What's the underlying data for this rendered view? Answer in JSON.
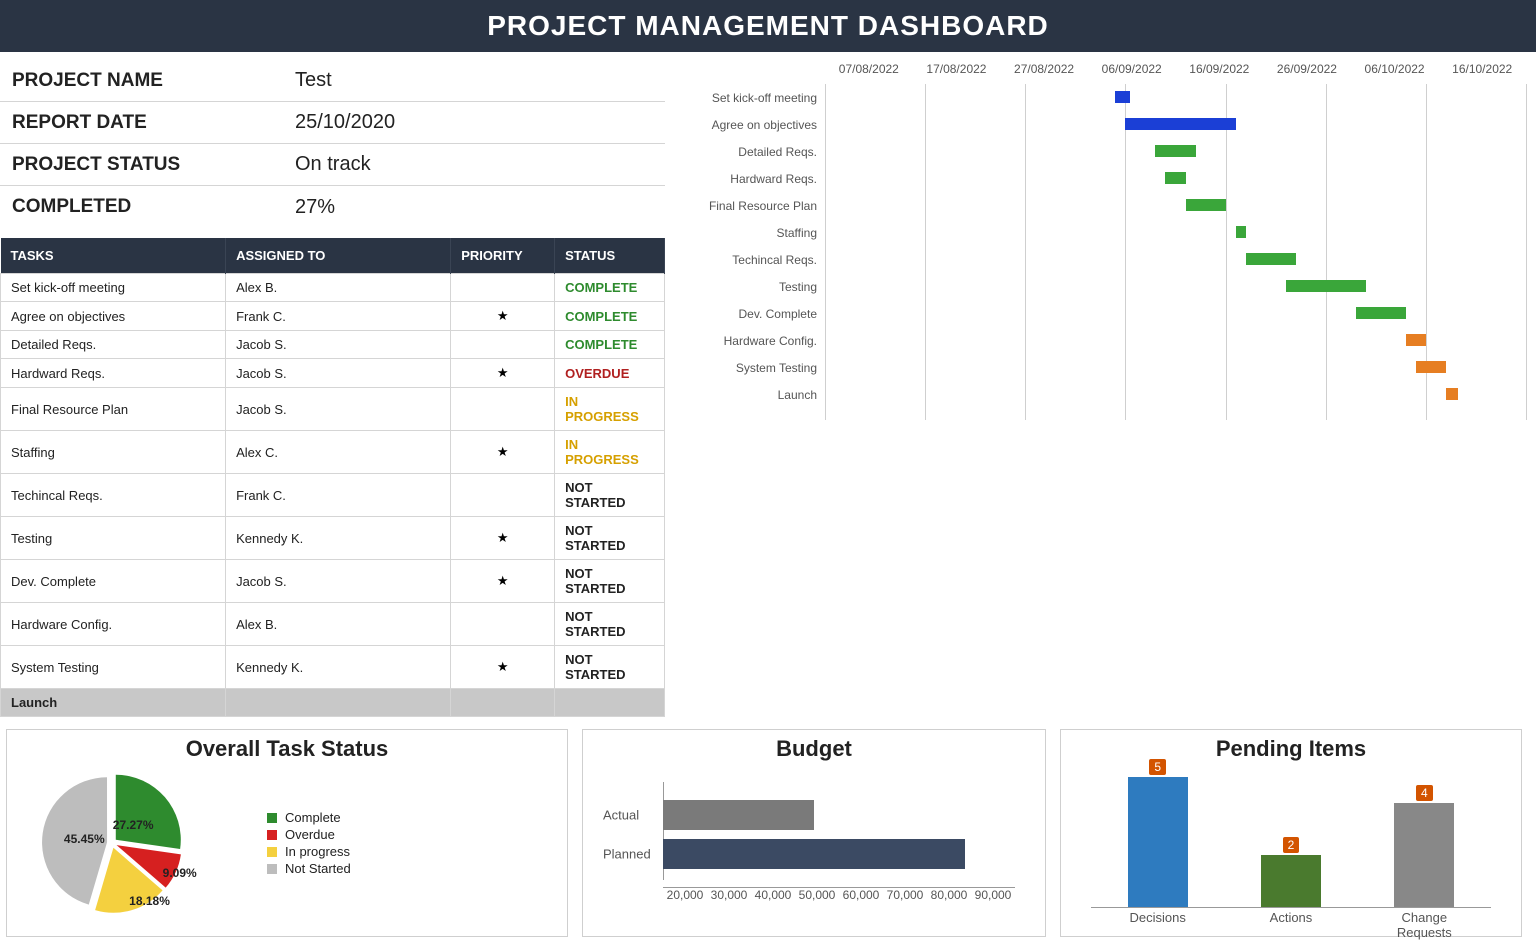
{
  "banner": "PROJECT MANAGEMENT DASHBOARD",
  "summary": [
    {
      "label": "PROJECT NAME",
      "value": "Test"
    },
    {
      "label": "REPORT DATE",
      "value": "25/10/2020"
    },
    {
      "label": "PROJECT STATUS",
      "value": "On track"
    },
    {
      "label": "COMPLETED",
      "value": "27%"
    }
  ],
  "task_table": {
    "headers": {
      "tasks": "TASKS",
      "assigned": "ASSIGNED TO",
      "priority": "PRIORITY",
      "status": "STATUS"
    },
    "status_colors": {
      "COMPLETE": "#2e8b2e",
      "OVERDUE": "#b02020",
      "IN PROGRESS": "#d6a000",
      "NOT STARTED": "#222222"
    },
    "rows": [
      {
        "task": "Set kick-off meeting",
        "assigned": "Alex B.",
        "priority": false,
        "status": "COMPLETE"
      },
      {
        "task": "Agree on objectives",
        "assigned": "Frank C.",
        "priority": true,
        "status": "COMPLETE"
      },
      {
        "task": "Detailed Reqs.",
        "assigned": "Jacob S.",
        "priority": false,
        "status": "COMPLETE"
      },
      {
        "task": "Hardward Reqs.",
        "assigned": "Jacob S.",
        "priority": true,
        "status": "OVERDUE"
      },
      {
        "task": "Final Resource Plan",
        "assigned": "Jacob S.",
        "priority": false,
        "status": "IN PROGRESS"
      },
      {
        "task": "Staffing",
        "assigned": "Alex C.",
        "priority": true,
        "status": "IN PROGRESS"
      },
      {
        "task": "Techincal Reqs.",
        "assigned": "Frank C.",
        "priority": false,
        "status": "NOT STARTED"
      },
      {
        "task": "Testing",
        "assigned": "Kennedy K.",
        "priority": true,
        "status": "NOT STARTED"
      },
      {
        "task": "Dev. Complete",
        "assigned": "Jacob S.",
        "priority": true,
        "status": "NOT STARTED"
      },
      {
        "task": "Hardware Config.",
        "assigned": "Alex B.",
        "priority": false,
        "status": "NOT STARTED"
      },
      {
        "task": "System Testing",
        "assigned": "Kennedy K.",
        "priority": true,
        "status": "NOT STARTED"
      }
    ],
    "footer": {
      "task": "Launch"
    },
    "star_glyph": "★"
  },
  "gantt": {
    "dates": [
      "07/08/2022",
      "17/08/2022",
      "27/08/2022",
      "06/09/2022",
      "16/09/2022",
      "26/09/2022",
      "06/10/2022",
      "16/10/2022"
    ],
    "x_range": [
      0,
      70
    ],
    "rows": [
      {
        "label": "Set kick-off meeting",
        "start": 29,
        "dur": 1.5,
        "color": "blue"
      },
      {
        "label": "Agree on objectives",
        "start": 30,
        "dur": 11,
        "color": "blue"
      },
      {
        "label": "Detailed Reqs.",
        "start": 33,
        "dur": 4,
        "color": "green"
      },
      {
        "label": "Hardward Reqs.",
        "start": 34,
        "dur": 2,
        "color": "green"
      },
      {
        "label": "Final Resource Plan",
        "start": 36,
        "dur": 4,
        "color": "green"
      },
      {
        "label": "Staffing",
        "start": 41,
        "dur": 1,
        "color": "green"
      },
      {
        "label": "Techincal Reqs.",
        "start": 42,
        "dur": 5,
        "color": "green"
      },
      {
        "label": "Testing",
        "start": 46,
        "dur": 8,
        "color": "green"
      },
      {
        "label": "Dev. Complete",
        "start": 53,
        "dur": 5,
        "color": "green"
      },
      {
        "label": "Hardware Config.",
        "start": 58,
        "dur": 2,
        "color": "orange"
      },
      {
        "label": "System Testing",
        "start": 59,
        "dur": 3,
        "color": "orange"
      },
      {
        "label": "Launch",
        "start": 62,
        "dur": 1.2,
        "color": "orange"
      }
    ]
  },
  "status_chart": {
    "title": "Overall Task Status",
    "legend": [
      {
        "label": "Complete",
        "color": "#2e8b2e"
      },
      {
        "label": "Overdue",
        "color": "#d62020"
      },
      {
        "label": "In progress",
        "color": "#f4d03f"
      },
      {
        "label": "Not Started",
        "color": "#bdbdbd"
      }
    ],
    "slices": [
      {
        "label": "27.27%",
        "value": 27.27,
        "color": "#2e8b2e"
      },
      {
        "label": "9.09%",
        "value": 9.09,
        "color": "#d62020"
      },
      {
        "label": "18.18%",
        "value": 18.18,
        "color": "#f4d03f"
      },
      {
        "label": "45.45%",
        "value": 45.45,
        "color": "#bdbdbd"
      }
    ]
  },
  "budget_chart": {
    "title": "Budget",
    "x_ticks": [
      "20,000",
      "30,000",
      "40,000",
      "50,000",
      "60,000",
      "70,000",
      "80,000",
      "90,000"
    ],
    "x_range": [
      20000,
      90000
    ],
    "series": [
      {
        "label": "Actual",
        "value": 50000,
        "color": "#7a7a7a"
      },
      {
        "label": "Planned",
        "value": 80000,
        "color": "#3b4a63"
      }
    ]
  },
  "pending_chart": {
    "title": "Pending Items",
    "y_max": 5,
    "items": [
      {
        "label": "Decisions",
        "value": 5,
        "color": "#2e7bbf"
      },
      {
        "label": "Actions",
        "value": 2,
        "color": "#4a7a2e"
      },
      {
        "label": "Change Requests",
        "value": 4,
        "color": "#888888"
      }
    ]
  },
  "chart_data": [
    {
      "type": "gantt",
      "title": "Project Timeline",
      "x_dates": [
        "07/08/2022",
        "17/08/2022",
        "27/08/2022",
        "06/09/2022",
        "16/09/2022",
        "26/09/2022",
        "06/10/2022",
        "16/10/2022"
      ],
      "tasks": [
        {
          "name": "Set kick-off meeting",
          "start": "06/09/2022",
          "duration_days": 1,
          "status": "complete"
        },
        {
          "name": "Agree on objectives",
          "start": "07/09/2022",
          "duration_days": 11,
          "status": "complete"
        },
        {
          "name": "Detailed Reqs.",
          "start": "10/09/2022",
          "duration_days": 4,
          "status": "on-track"
        },
        {
          "name": "Hardward Reqs.",
          "start": "11/09/2022",
          "duration_days": 2,
          "status": "on-track"
        },
        {
          "name": "Final Resource Plan",
          "start": "13/09/2022",
          "duration_days": 4,
          "status": "on-track"
        },
        {
          "name": "Staffing",
          "start": "18/09/2022",
          "duration_days": 1,
          "status": "on-track"
        },
        {
          "name": "Techincal Reqs.",
          "start": "19/09/2022",
          "duration_days": 5,
          "status": "on-track"
        },
        {
          "name": "Testing",
          "start": "23/09/2022",
          "duration_days": 8,
          "status": "on-track"
        },
        {
          "name": "Dev. Complete",
          "start": "30/09/2022",
          "duration_days": 5,
          "status": "on-track"
        },
        {
          "name": "Hardware Config.",
          "start": "05/10/2022",
          "duration_days": 2,
          "status": "late"
        },
        {
          "name": "System Testing",
          "start": "06/10/2022",
          "duration_days": 3,
          "status": "late"
        },
        {
          "name": "Launch",
          "start": "09/10/2022",
          "duration_days": 1,
          "status": "late"
        }
      ]
    },
    {
      "type": "pie",
      "title": "Overall Task Status",
      "categories": [
        "Complete",
        "Overdue",
        "In progress",
        "Not Started"
      ],
      "values": [
        27.27,
        9.09,
        18.18,
        45.45
      ]
    },
    {
      "type": "bar",
      "title": "Budget",
      "orientation": "horizontal",
      "categories": [
        "Actual",
        "Planned"
      ],
      "values": [
        50000,
        80000
      ],
      "xlabel": "",
      "ylabel": "",
      "xlim": [
        20000,
        90000
      ]
    },
    {
      "type": "bar",
      "title": "Pending Items",
      "categories": [
        "Decisions",
        "Actions",
        "Change Requests"
      ],
      "values": [
        5,
        2,
        4
      ],
      "ylim": [
        0,
        5
      ]
    }
  ]
}
